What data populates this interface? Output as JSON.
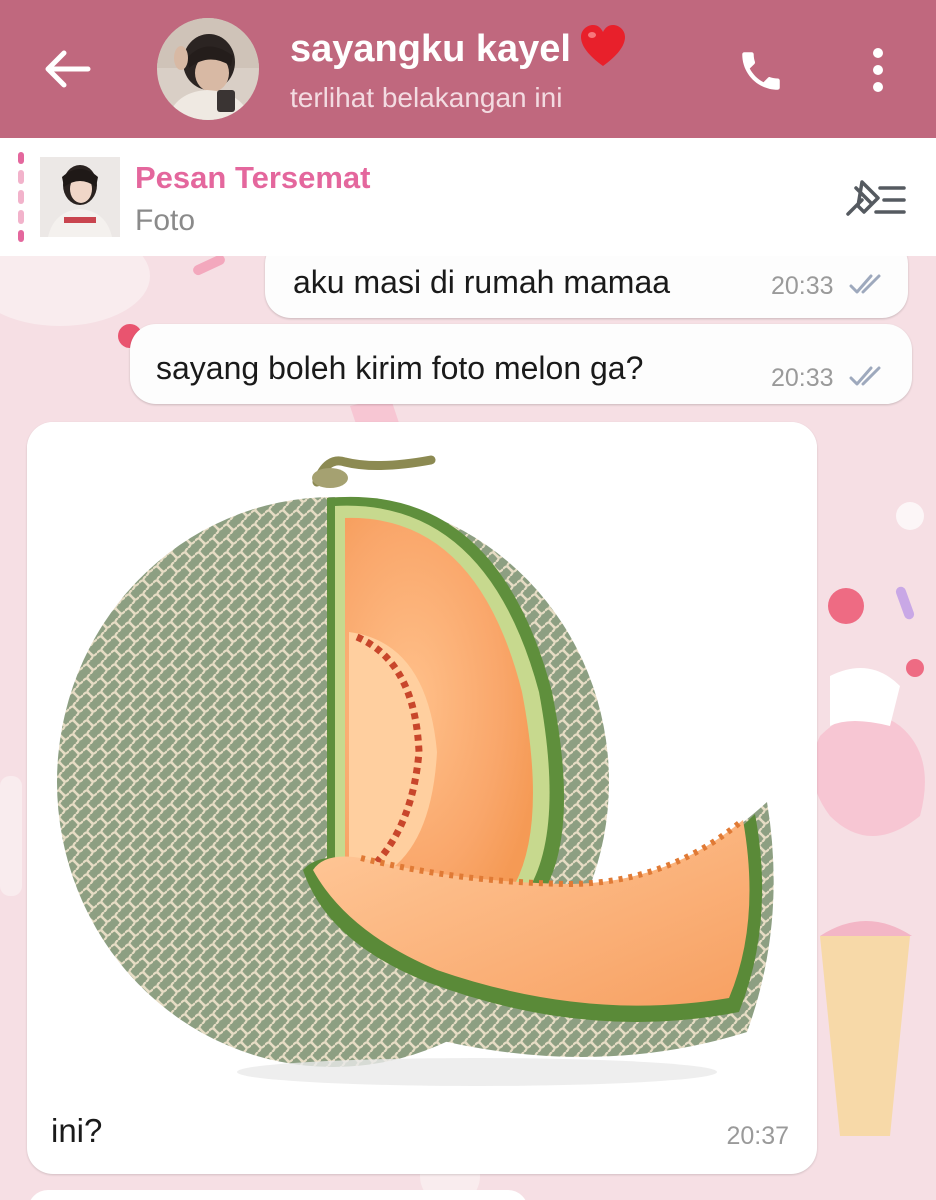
{
  "header": {
    "title": "sayangku kayel",
    "subtitle": "terlihat belakangan ini",
    "accent_color": "#c0687e",
    "icons": [
      "back-arrow-icon",
      "avatar",
      "heart-emoji",
      "phone-icon",
      "more-vert-icon"
    ]
  },
  "pinned": {
    "title": "Pesan Tersemat",
    "subtitle": "Foto",
    "title_color": "#e4679d",
    "icons": [
      "pin-list-icon"
    ]
  },
  "messages": [
    {
      "direction": "out",
      "text": "aku masi di rumah mamaa",
      "time": "20:33",
      "status": "read"
    },
    {
      "direction": "out",
      "text": "sayang boleh kirim foto melon ga?",
      "time": "20:33",
      "status": "read"
    },
    {
      "direction": "in",
      "type": "photo",
      "image": "melon",
      "caption": "ini?",
      "time": "20:37"
    }
  ]
}
